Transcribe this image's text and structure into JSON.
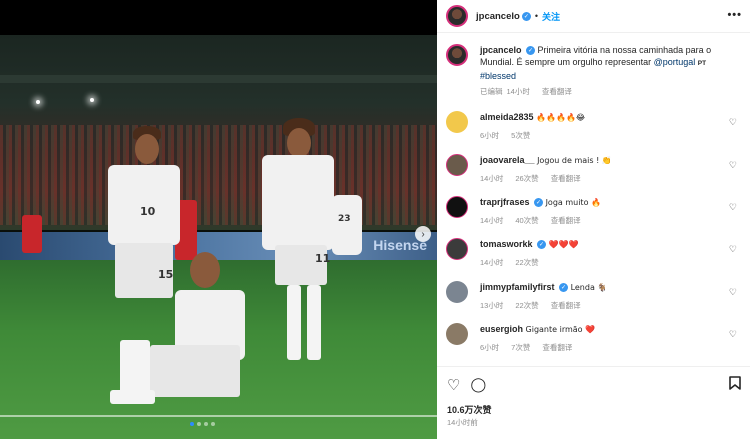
{
  "header": {
    "username": "jpcancelo",
    "follow_label": "关注",
    "more_label": "•••"
  },
  "caption": {
    "username": "jpcancelo",
    "text": "Primeira vitória na nossa caminhada para o Mundial. É sempre um orgulho representar",
    "mention": "@portugal",
    "mention_suffix": "PT",
    "hashtag": "#blessed",
    "edited": "已编辑",
    "time": "14小时",
    "translate": "查看翻译"
  },
  "comments": [
    {
      "username": "almeida2835",
      "text": "🔥🔥🔥🔥😂",
      "time": "6小时",
      "likes": "5次赞",
      "translate": "",
      "verified": false,
      "avatar_color": "#f2c84b"
    },
    {
      "username": "joaovarela__",
      "text": "Jogou de mais ! 👏",
      "time": "14小时",
      "likes": "26次赞",
      "translate": "查看翻译",
      "verified": false,
      "avatar_color": "#6a5b4b"
    },
    {
      "username": "traprjfrases",
      "text": "Joga muito 🔥",
      "time": "14小时",
      "likes": "40次赞",
      "translate": "查看翻译",
      "verified": true,
      "avatar_color": "#111111"
    },
    {
      "username": "tomasworkk",
      "text": "❤️❤️❤️",
      "time": "14小时",
      "likes": "22次赞",
      "translate": "",
      "verified": true,
      "avatar_color": "#3b3b3b"
    },
    {
      "username": "jimmypfamilyfirst",
      "text": "Lenda 🐐",
      "time": "13小时",
      "likes": "22次赞",
      "translate": "查看翻译",
      "verified": true,
      "avatar_color": "#7b8591"
    },
    {
      "username": "eusergioh",
      "text": "Gigante irmão ❤️",
      "time": "6小时",
      "likes": "7次赞",
      "translate": "查看翻译",
      "verified": false,
      "avatar_color": "#8a7a66"
    }
  ],
  "actions": {
    "like_icon": "heart-outline-icon",
    "comment_icon": "comment-bubble-icon",
    "save_icon": "bookmark-icon",
    "likes_count": "10.6万次赞",
    "posted_time": "14小时前"
  },
  "photo": {
    "board_text": "Hisense",
    "jersey_numbers": [
      "10",
      "15",
      "11",
      "23"
    ],
    "carousel_dots": 4,
    "carousel_active": 1
  },
  "colors": {
    "accent": "#0095f6",
    "verified": "#3897f0",
    "story_ring": "#d52f7b"
  }
}
